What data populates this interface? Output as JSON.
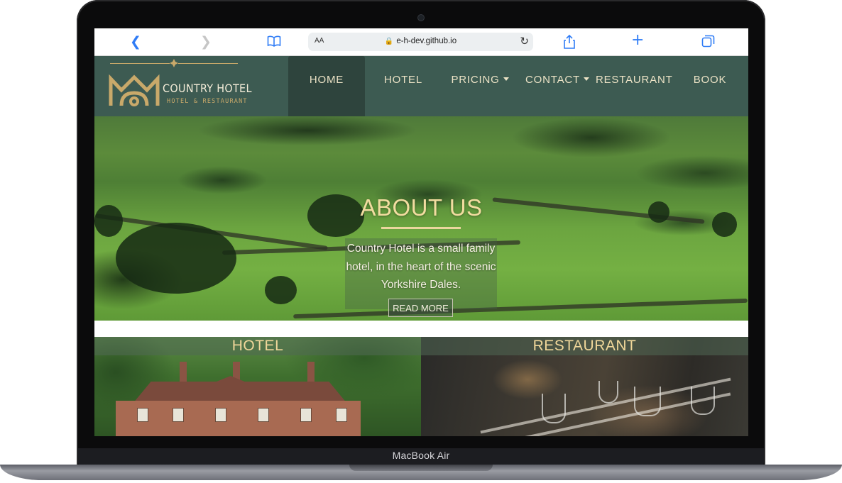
{
  "device": {
    "model_label": "MacBook Air"
  },
  "browser": {
    "url_text_size": "AA",
    "url": "e-h-dev.github.io",
    "icons": [
      "chevron-left-icon",
      "chevron-right-icon",
      "book-icon",
      "lock-icon",
      "reload-icon",
      "share-icon",
      "plus-icon",
      "tabs-icon"
    ]
  },
  "site": {
    "logo": {
      "title": "COUNTRY HOTEL",
      "subtitle": "HOTEL & RESTAURANT"
    },
    "nav": {
      "home": "HOME",
      "hotel": "HOTEL",
      "pricing": "PRICING",
      "contact": "CONTACT",
      "restaurant": "RESTAURANT",
      "book": "BOOK"
    },
    "hero": {
      "title": "ABOUT US",
      "text": "Country Hotel is a small family hotel, in the heart of the scenic Yorkshire Dales.",
      "button": "READ MORE"
    },
    "cards": {
      "hotel": "HOTEL",
      "restaurant": "RESTAURANT"
    }
  },
  "colors": {
    "nav_bg": "#3d5b52",
    "nav_active_bg": "#2e443d",
    "accent_gold": "#f0d79a",
    "link_blue": "#2f7cf6"
  }
}
